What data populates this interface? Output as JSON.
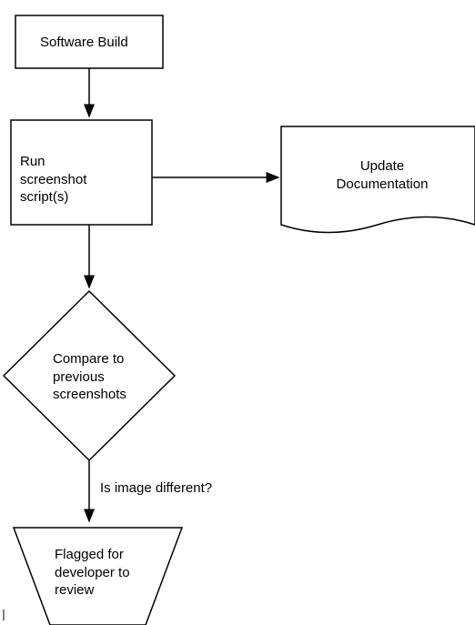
{
  "flowchart": {
    "nodes": {
      "software_build": "Software Build",
      "run_scripts_line1": "Run",
      "run_scripts_line2": "screenshot",
      "run_scripts_line3": "script(s)",
      "update_doc_line1": "Update",
      "update_doc_line2": "Documentation",
      "compare_line1": "Compare to",
      "compare_line2": "previous",
      "compare_line3": "screenshots",
      "decision_label": "Is image different?",
      "flagged_line1": "Flagged for",
      "flagged_line2": "developer to",
      "flagged_line3": "review"
    }
  }
}
